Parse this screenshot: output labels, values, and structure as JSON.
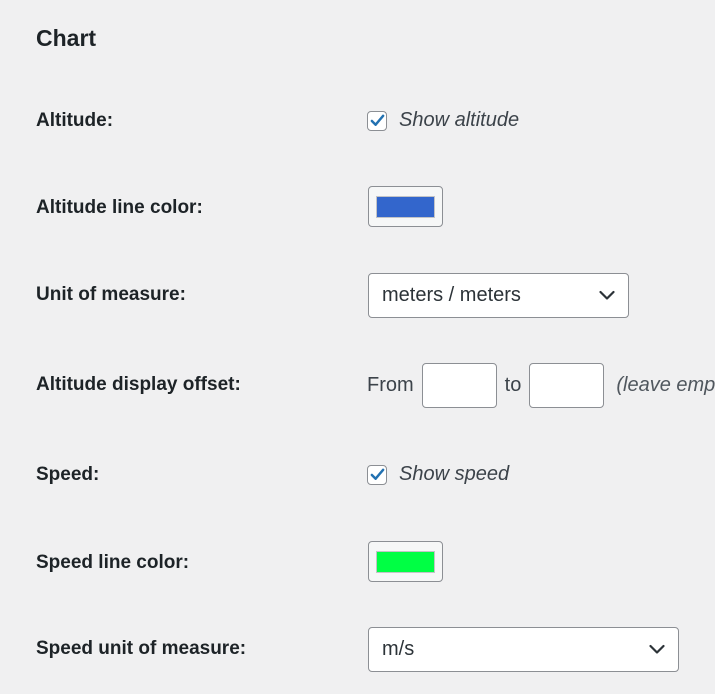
{
  "section": {
    "title": "Chart"
  },
  "altitude": {
    "label": "Altitude:",
    "checkbox_label": "Show altitude",
    "checked": true
  },
  "altitude_color": {
    "label": "Altitude line color:",
    "color": "#3366cc"
  },
  "unit": {
    "label": "Unit of measure:",
    "value": "meters / meters"
  },
  "offset": {
    "label": "Altitude display offset:",
    "from_label": "From",
    "to_label": "to",
    "from_value": "",
    "to_value": "",
    "hint": "(leave emp"
  },
  "speed": {
    "label": "Speed:",
    "checkbox_label": "Show speed",
    "checked": true
  },
  "speed_color": {
    "label": "Speed line color:",
    "color": "#00ff44"
  },
  "speed_unit": {
    "label": "Speed unit of measure:",
    "value": "m/s"
  },
  "icons": {
    "checkmark": "checkmark-icon",
    "dropdown": "chevron-down-icon"
  },
  "colors": {
    "checkmark": "#2271b1",
    "border": "#8c8f94"
  }
}
